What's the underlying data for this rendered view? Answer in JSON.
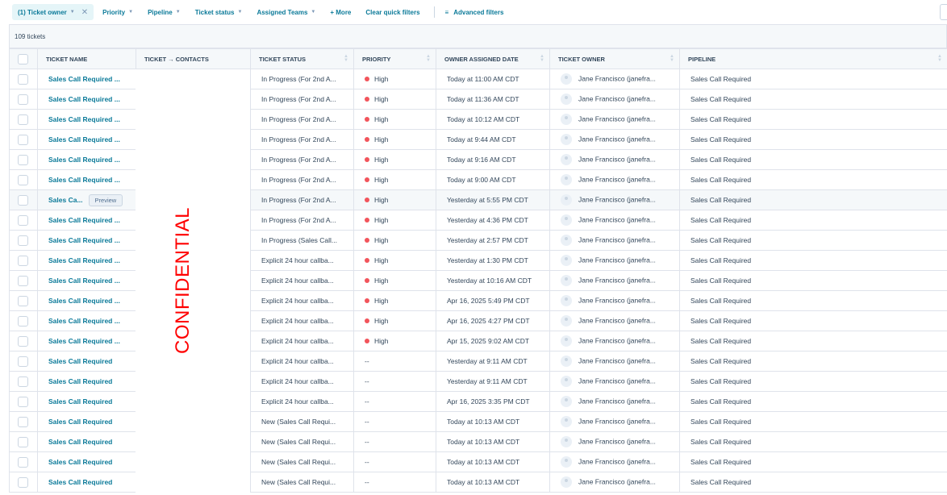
{
  "filters": {
    "ticket_owner": "(1) Ticket owner",
    "priority": "Priority",
    "pipeline": "Pipeline",
    "ticket_status": "Ticket status",
    "assigned_teams": "Assigned Teams",
    "more": "+ More",
    "clear": "Clear quick filters",
    "advanced": "Advanced filters"
  },
  "count": "109 tickets",
  "columns": [
    "TICKET NAME",
    "TICKET → CONTACTS",
    "TICKET STATUS",
    "PRIORITY",
    "OWNER ASSIGNED DATE",
    "TICKET OWNER",
    "PIPELINE"
  ],
  "watermark": "CONFIDENTIAL",
  "preview_label": "Preview",
  "colors": {
    "accent": "#0b7a99",
    "high_priority": "#f2545b",
    "watermark": "#ff0000"
  },
  "rows": [
    {
      "name": "Sales Call Required ...",
      "status": "In Progress (For 2nd A...",
      "priority": "High",
      "date": "Today at 11:00 AM CDT",
      "owner": "Jane Francisco (janefra...",
      "pipeline": "Sales Call Required"
    },
    {
      "name": "Sales Call Required ...",
      "status": "In Progress (For 2nd A...",
      "priority": "High",
      "date": "Today at 11:36 AM CDT",
      "owner": "Jane Francisco (janefra...",
      "pipeline": "Sales Call Required"
    },
    {
      "name": "Sales Call Required ...",
      "status": "In Progress (For 2nd A...",
      "priority": "High",
      "date": "Today at 10:12 AM CDT",
      "owner": "Jane Francisco (janefra...",
      "pipeline": "Sales Call Required"
    },
    {
      "name": "Sales Call Required ...",
      "status": "In Progress (For 2nd A...",
      "priority": "High",
      "date": "Today at 9:44 AM CDT",
      "owner": "Jane Francisco (janefra...",
      "pipeline": "Sales Call Required"
    },
    {
      "name": "Sales Call Required ...",
      "status": "In Progress (For 2nd A...",
      "priority": "High",
      "date": "Today at 9:16 AM CDT",
      "owner": "Jane Francisco (janefra...",
      "pipeline": "Sales Call Required"
    },
    {
      "name": "Sales Call Required ...",
      "status": "In Progress (For 2nd A...",
      "priority": "High",
      "date": "Today at 9:00 AM CDT",
      "owner": "Jane Francisco (janefra...",
      "pipeline": "Sales Call Required"
    },
    {
      "name": "Sales Ca...",
      "status": "In Progress (For 2nd A...",
      "priority": "High",
      "date": "Yesterday at 5:55 PM CDT",
      "owner": "Jane Francisco (janefra...",
      "pipeline": "Sales Call Required",
      "hover": true
    },
    {
      "name": "Sales Call Required ...",
      "status": "In Progress (For 2nd A...",
      "priority": "High",
      "date": "Yesterday at 4:36 PM CDT",
      "owner": "Jane Francisco (janefra...",
      "pipeline": "Sales Call Required"
    },
    {
      "name": "Sales Call Required ...",
      "status": "In Progress (Sales Call...",
      "priority": "High",
      "date": "Yesterday at 2:57 PM CDT",
      "owner": "Jane Francisco (janefra...",
      "pipeline": "Sales Call Required"
    },
    {
      "name": "Sales Call Required ...",
      "status": "Explicit 24 hour callba...",
      "priority": "High",
      "date": "Yesterday at 1:30 PM CDT",
      "owner": "Jane Francisco (janefra...",
      "pipeline": "Sales Call Required"
    },
    {
      "name": "Sales Call Required ...",
      "status": "Explicit 24 hour callba...",
      "priority": "High",
      "date": "Yesterday at 10:16 AM CDT",
      "owner": "Jane Francisco (janefra...",
      "pipeline": "Sales Call Required"
    },
    {
      "name": "Sales Call Required ...",
      "status": "Explicit 24 hour callba...",
      "priority": "High",
      "date": "Apr 16, 2025 5:49 PM CDT",
      "owner": "Jane Francisco (janefra...",
      "pipeline": "Sales Call Required"
    },
    {
      "name": "Sales Call Required ...",
      "status": "Explicit 24 hour callba...",
      "priority": "High",
      "date": "Apr 16, 2025 4:27 PM CDT",
      "owner": "Jane Francisco (janefra...",
      "pipeline": "Sales Call Required"
    },
    {
      "name": "Sales Call Required ...",
      "status": "Explicit 24 hour callba...",
      "priority": "High",
      "date": "Apr 15, 2025 9:02 AM CDT",
      "owner": "Jane Francisco (janefra...",
      "pipeline": "Sales Call Required"
    },
    {
      "name": "Sales Call Required",
      "status": "Explicit 24 hour callba...",
      "priority": "--",
      "date": "Yesterday at 9:11 AM CDT",
      "owner": "Jane Francisco (janefra...",
      "pipeline": "Sales Call Required"
    },
    {
      "name": "Sales Call Required",
      "status": "Explicit 24 hour callba...",
      "priority": "--",
      "date": "Yesterday at 9:11 AM CDT",
      "owner": "Jane Francisco (janefra...",
      "pipeline": "Sales Call Required"
    },
    {
      "name": "Sales Call Required",
      "status": "Explicit 24 hour callba...",
      "priority": "--",
      "date": "Apr 16, 2025 3:35 PM CDT",
      "owner": "Jane Francisco (janefra...",
      "pipeline": "Sales Call Required"
    },
    {
      "name": "Sales Call Required",
      "status": "New (Sales Call Requi...",
      "priority": "--",
      "date": "Today at 10:13 AM CDT",
      "owner": "Jane Francisco (janefra...",
      "pipeline": "Sales Call Required"
    },
    {
      "name": "Sales Call Required",
      "status": "New (Sales Call Requi...",
      "priority": "--",
      "date": "Today at 10:13 AM CDT",
      "owner": "Jane Francisco (janefra...",
      "pipeline": "Sales Call Required"
    },
    {
      "name": "Sales Call Required",
      "status": "New (Sales Call Requi...",
      "priority": "--",
      "date": "Today at 10:13 AM CDT",
      "owner": "Jane Francisco (janefra...",
      "pipeline": "Sales Call Required"
    },
    {
      "name": "Sales Call Required",
      "status": "New (Sales Call Requi...",
      "priority": "--",
      "date": "Today at 10:13 AM CDT",
      "owner": "Jane Francisco (janefra...",
      "pipeline": "Sales Call Required"
    }
  ]
}
